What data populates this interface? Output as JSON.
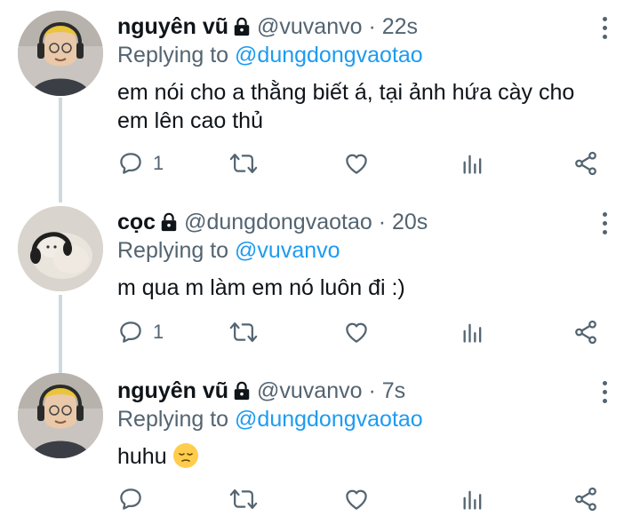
{
  "tweets": [
    {
      "name": "nguyên vũ",
      "handle": "@vuvanvo",
      "separator": "·",
      "time": "22s",
      "replying_prefix": "Replying to",
      "replying_to": "@dungdongvaotao",
      "text_line1": "em nói cho a thằng biết á, tại ảnh hứa cày cho",
      "text_line2": "em lên cao thủ",
      "reply_count": "1"
    },
    {
      "name": "cọc",
      "handle": "@dungdongvaotao",
      "separator": "·",
      "time": "20s",
      "replying_prefix": "Replying to",
      "replying_to": "@vuvanvo",
      "text_line1": "m qua m làm em nó luôn đi :)",
      "reply_count": "1"
    },
    {
      "name": "nguyên vũ",
      "handle": "@vuvanvo",
      "separator": "·",
      "time": "7s",
      "replying_prefix": "Replying to",
      "replying_to": "@dungdongvaotao",
      "text_line1": "huhu",
      "reply_count": ""
    }
  ],
  "icons": {
    "lock": "lock-icon",
    "reply": "reply-icon",
    "retweet": "retweet-icon",
    "like": "heart-icon",
    "analytics": "analytics-icon",
    "share": "share-icon",
    "more": "more-vertical-icon",
    "emoji": "pensive-face-emoji"
  },
  "colors": {
    "name": "#0f1419",
    "secondary": "#536471",
    "mention": "#1d9bf0",
    "thread_line": "#cfd9de"
  }
}
